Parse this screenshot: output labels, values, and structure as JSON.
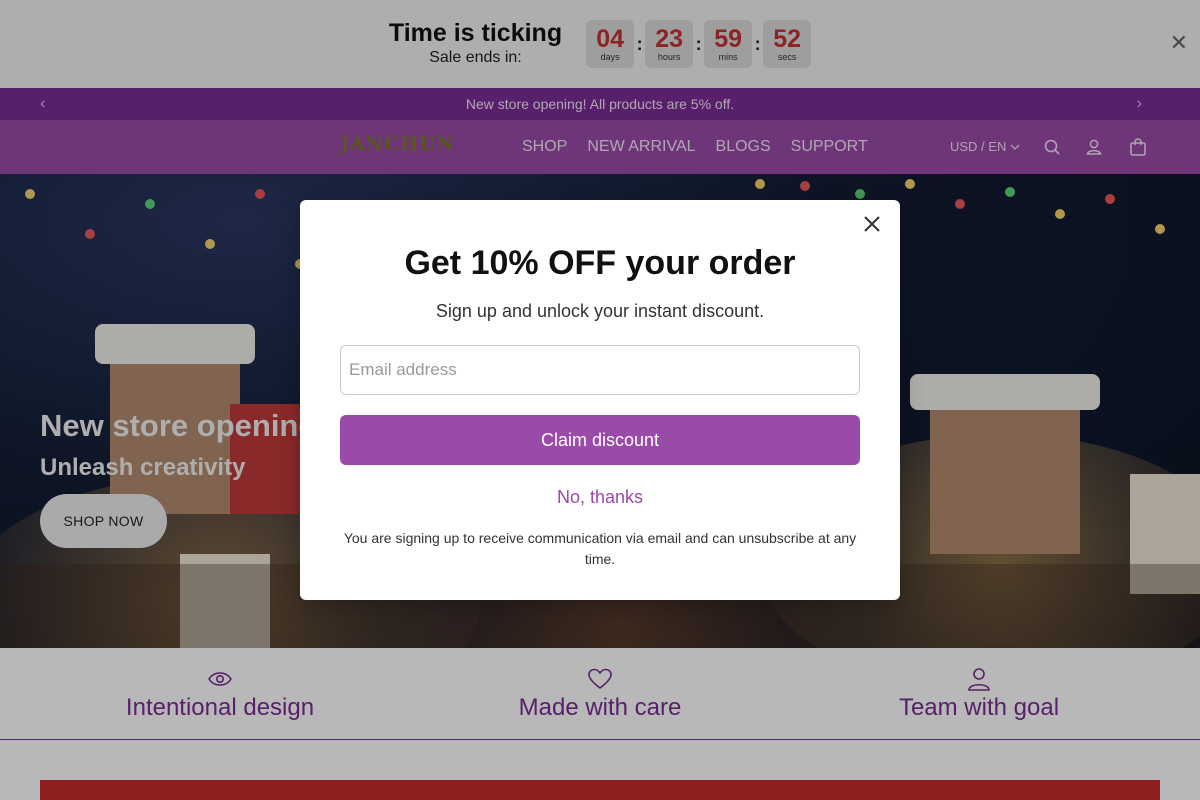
{
  "countdown": {
    "title": "Time is ticking",
    "subtitle": "Sale ends in:",
    "units": [
      {
        "value": "04",
        "label": "days"
      },
      {
        "value": "23",
        "label": "hours"
      },
      {
        "value": "59",
        "label": "mins"
      },
      {
        "value": "52",
        "label": "secs"
      }
    ],
    "separator": ":",
    "close_icon": "close-icon"
  },
  "announcement": {
    "text": "New store opening! All products are 5% off."
  },
  "header": {
    "logo": "JANCHUN",
    "nav": [
      "SHOP",
      "NEW ARRIVAL",
      "BLOGS",
      "SUPPORT"
    ],
    "locale": "USD / EN",
    "icons": [
      "search-icon",
      "account-icon",
      "cart-icon"
    ]
  },
  "hero": {
    "heading": "New store opening!",
    "subheading": "Unleash creativity",
    "button": "SHOP NOW"
  },
  "features": [
    {
      "icon": "eye-icon",
      "label": "Intentional design"
    },
    {
      "icon": "heart-icon",
      "label": "Made with care"
    },
    {
      "icon": "person-icon",
      "label": "Team with goal"
    }
  ],
  "modal": {
    "title": "Get 10% OFF your order",
    "subtitle": "Sign up and unlock your instant discount.",
    "email_placeholder": "Email address",
    "email_value": "",
    "claim_button": "Claim discount",
    "decline": "No, thanks",
    "legal": "You are signing up to receive communication via email and can unsubscribe at any time."
  },
  "colors": {
    "brand": "#9a4aa8",
    "brand_dark": "#7a2d94",
    "countdown_number": "#c23232"
  }
}
